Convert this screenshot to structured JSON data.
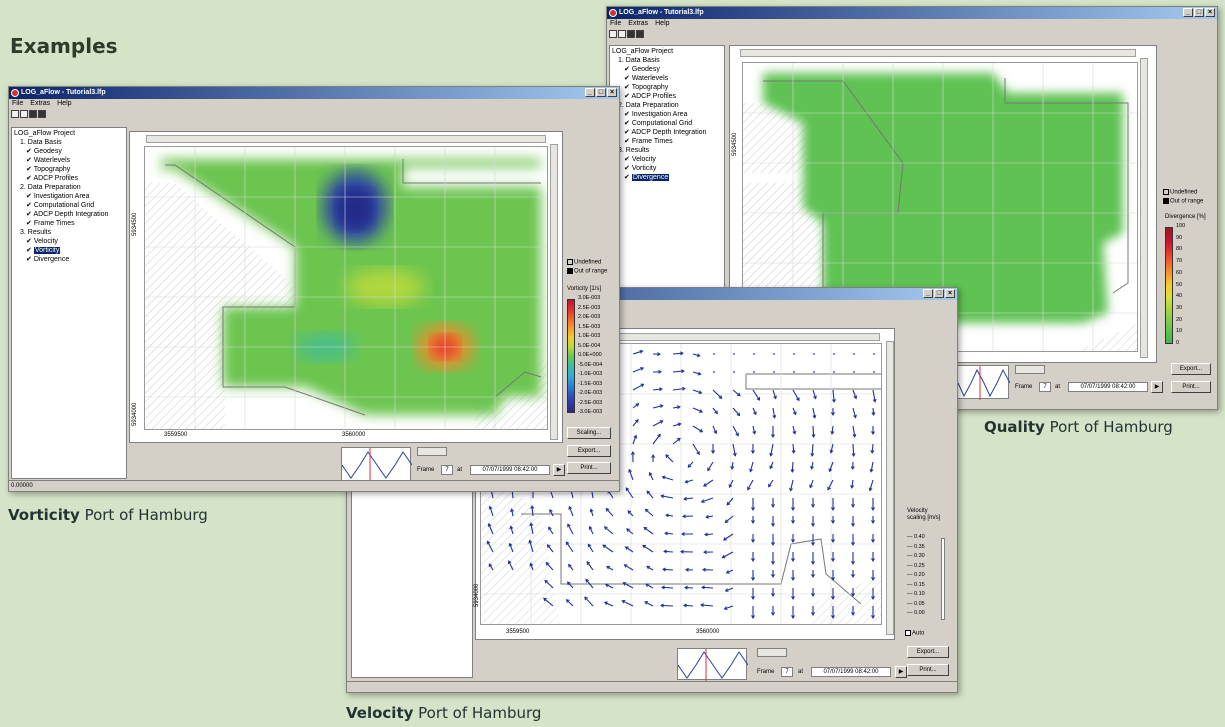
{
  "page": {
    "heading": "Examples"
  },
  "captions": {
    "vorticity": {
      "bold": "Vorticity",
      "rest": " Port of Hamburg"
    },
    "velocity": {
      "bold": "Velocity",
      "rest": " Port of Hamburg"
    },
    "quality": {
      "bold": "Quality",
      "rest": " Port of Hamburg"
    }
  },
  "app": {
    "title": "LOG_aFlow - Tutorial3.lfp",
    "menu": [
      "File",
      "Extras",
      "Help"
    ],
    "tree": {
      "root": "LOG_aFlow Project",
      "s1": "1. Data Basis",
      "s1_items": [
        "Geodesy",
        "Waterlevels",
        "Topography",
        "ADCP Profiles"
      ],
      "s2": "2. Data Preparation",
      "s2_items": [
        "Investigation Area",
        "Computational Grid",
        "ADCP Depth Integration",
        "Frame Times"
      ],
      "s3": "3. Results",
      "s3_items": [
        "Velocity",
        "Vorticity",
        "Divergence"
      ]
    },
    "frame_label": "Frame",
    "frame_value": "7",
    "at_label": "at",
    "timestamp": "07/07/1999 08:42:00",
    "buttons": {
      "scaling": "Scaling...",
      "export": "Export...",
      "print": "Print..."
    },
    "undefined_label": "Undefined",
    "out_of_range_label": "Out of range"
  },
  "vorticity_window": {
    "status": "0.00000",
    "x_ticks": [
      "3559500",
      "3560000"
    ],
    "y_ticks": [
      "5934500",
      "5934000"
    ],
    "legend_title": "Vorticity [1/s]",
    "legend_values": [
      "3.0E-003",
      "2.5E-003",
      "2.0E-003",
      "1.5E-003",
      "1.0E-003",
      "5.0E-004",
      "0.0E+000",
      "-5.0E-004",
      "-1.0E-003",
      "-1.5E-003",
      "-2.0E-003",
      "-2.5E-003",
      "-3.0E-003"
    ],
    "legend_colors": [
      "#c8102e",
      "#e3312a",
      "#f2652a",
      "#f59a2a",
      "#f3cc2d",
      "#b8d93a",
      "#6fc651",
      "#3dbf9a",
      "#35b2d3",
      "#2b8bd6",
      "#2a5dc6",
      "#2b3aa6",
      "#2a2a80"
    ]
  },
  "quality_window": {
    "x_ticks": [
      "3560000"
    ],
    "y_ticks": [
      "5934500"
    ],
    "legend_title": "Divergence [%]",
    "legend_values": [
      "100",
      "90",
      "80",
      "70",
      "60",
      "50",
      "40",
      "30",
      "20",
      "10",
      "0"
    ],
    "legend_colors": [
      "#9a1a1a",
      "#c8102e",
      "#e3312a",
      "#f2652a",
      "#f59a2a",
      "#f3cc2d",
      "#d9e23a",
      "#a9d63f",
      "#7fcc46",
      "#5ec24b",
      "#3fb84f"
    ]
  },
  "velocity_window": {
    "x_ticks": [
      "3559500",
      "3560000"
    ],
    "y_ticks": [
      "5934000"
    ],
    "scale_title": "Velocity scaling [m/s]",
    "scale_values": [
      "0.40",
      "0.35",
      "0.30",
      "0.25",
      "0.20",
      "0.15",
      "0.10",
      "0.05",
      "0.00"
    ],
    "auto_label": "Auto"
  }
}
